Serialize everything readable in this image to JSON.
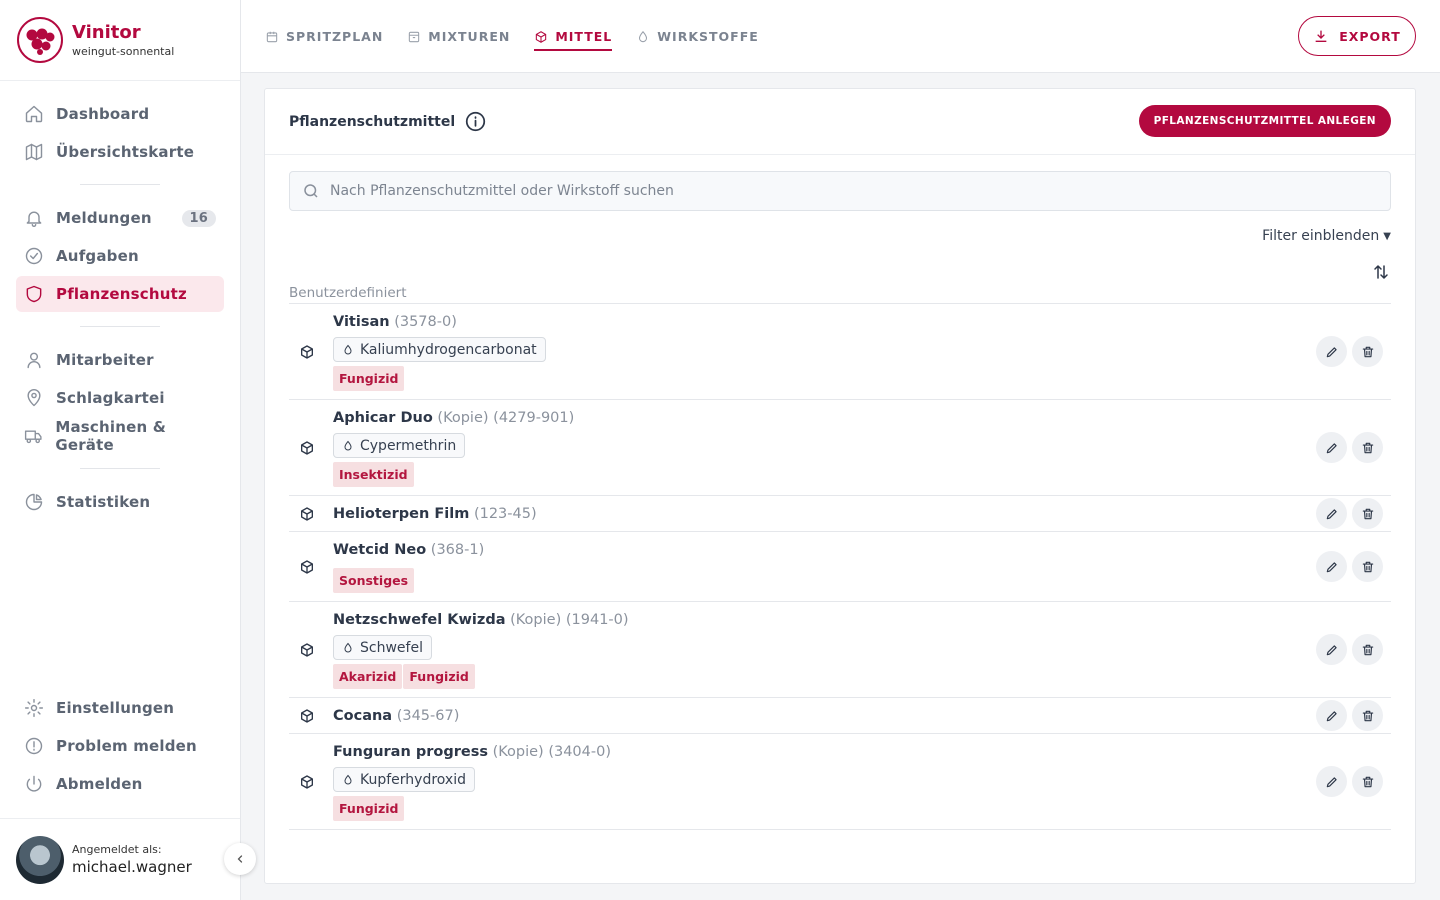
{
  "brand": {
    "name": "Vinitor",
    "sub": "weingut-sonnental"
  },
  "nav": {
    "primary": [
      {
        "label": "Dashboard",
        "icon": "home-icon"
      },
      {
        "label": "Übersichtskarte",
        "icon": "map-icon"
      }
    ],
    "secondary": [
      {
        "label": "Meldungen",
        "icon": "bell-icon",
        "badge": "16"
      },
      {
        "label": "Aufgaben",
        "icon": "check-circle-icon"
      },
      {
        "label": "Pflanzenschutz",
        "icon": "shield-icon",
        "active": true
      }
    ],
    "tertiary": [
      {
        "label": "Mitarbeiter",
        "icon": "user-icon"
      },
      {
        "label": "Schlagkartei",
        "icon": "location-pin-icon"
      },
      {
        "label": "Maschinen & Geräte",
        "icon": "truck-icon"
      }
    ],
    "quaternary": [
      {
        "label": "Statistiken",
        "icon": "pie-chart-icon"
      }
    ],
    "bottom": [
      {
        "label": "Einstellungen",
        "icon": "gear-icon"
      },
      {
        "label": "Problem melden",
        "icon": "alert-circle-icon"
      },
      {
        "label": "Abmelden",
        "icon": "power-icon"
      }
    ]
  },
  "user": {
    "label": "Angemeldet als:",
    "name": "michael.wagner"
  },
  "tabs": [
    {
      "label": "SPRITZPLAN",
      "icon": "calendar-icon"
    },
    {
      "label": "MIXTUREN",
      "icon": "archive-icon"
    },
    {
      "label": "MITTEL",
      "icon": "box-icon",
      "active": true
    },
    {
      "label": "WIRKSTOFFE",
      "icon": "droplet-icon"
    }
  ],
  "export_label": "EXPORT",
  "card": {
    "title": "Pflanzenschutzmittel",
    "add_label": "PFLANZENSCHUTZMITTEL ANLEGEN",
    "search_placeholder": "Nach Pflanzenschutzmittel oder Wirkstoff suchen",
    "filter_label": "Filter einblenden",
    "section_label": "Benutzerdefiniert"
  },
  "products": [
    {
      "name": "Vitisan",
      "copy": "",
      "reg": "(3578-0)",
      "ingredient": "Kaliumhydrogencarbonat",
      "tags": [
        "Fungizid"
      ]
    },
    {
      "name": "Aphicar Duo",
      "copy": "(Kopie)",
      "reg": "(4279-901)",
      "ingredient": "Cypermethrin",
      "tags": [
        "Insektizid"
      ]
    },
    {
      "name": "Helioterpen Film",
      "copy": "",
      "reg": "(123-45)",
      "ingredient": "",
      "tags": []
    },
    {
      "name": "Wetcid Neo",
      "copy": "",
      "reg": "(368-1)",
      "ingredient": "",
      "tags": [
        "Sonstiges"
      ]
    },
    {
      "name": "Netzschwefel Kwizda",
      "copy": "(Kopie)",
      "reg": "(1941-0)",
      "ingredient": "Schwefel",
      "tags": [
        "Akarizid",
        "Fungizid"
      ]
    },
    {
      "name": "Cocana",
      "copy": "",
      "reg": "(345-67)",
      "ingredient": "",
      "tags": []
    },
    {
      "name": "Funguran progress",
      "copy": "(Kopie)",
      "reg": "(3404-0)",
      "ingredient": "Kupferhydroxid",
      "tags": [
        "Fungizid"
      ]
    }
  ],
  "colors": {
    "accent": "#b3093f",
    "tag_bg": "#f6dfe1",
    "active_nav_bg": "#fbe8ec"
  }
}
